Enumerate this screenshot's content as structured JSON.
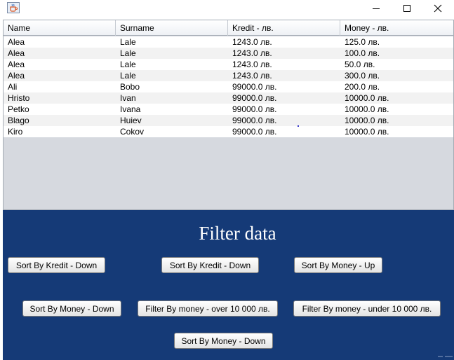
{
  "window": {
    "icon": "java-cup-icon",
    "controls": [
      "minimize-icon",
      "maximize-icon",
      "close-icon"
    ]
  },
  "table": {
    "columns": [
      "Name",
      "Surname",
      "Kredit - лв.",
      "Money - лв."
    ],
    "rows": [
      [
        "Alea",
        "Lale",
        "1243.0 лв.",
        "125.0 лв."
      ],
      [
        "Alea",
        "Lale",
        "1243.0 лв.",
        "100.0 лв."
      ],
      [
        "Alea",
        "Lale",
        "1243.0 лв.",
        "50.0 лв."
      ],
      [
        "Alea",
        "Lale",
        "1243.0 лв.",
        "300.0 лв."
      ],
      [
        "Ali",
        "Bobo",
        "99000.0 лв.",
        "200.0 лв."
      ],
      [
        "Hristo",
        "Ivan",
        "99000.0 лв.",
        "10000.0 лв."
      ],
      [
        "Petko",
        "Ivana",
        "99000.0 лв.",
        "10000.0 лв."
      ],
      [
        "Blago",
        "Huiev",
        "99000.0 лв.",
        "10000.0 лв."
      ],
      [
        "Kiro",
        "Cokov",
        "99000.0 лв.",
        "10000.0 лв."
      ]
    ]
  },
  "panel": {
    "title": "Filter data",
    "background": "#153a77",
    "buttons": {
      "sort_kredit_down": "Sort By Kredit - Down",
      "sort_kredit_down_2": "Sort By Kredit - Down",
      "sort_money_up": "Sort By Money - Up",
      "sort_money_down": "Sort By Money - Down",
      "filter_over": "Filter By money - over 10 000 лв.",
      "filter_under": "Filter By money - under 10 000 лв.",
      "sort_money_down_2": "Sort By Money - Down"
    }
  }
}
